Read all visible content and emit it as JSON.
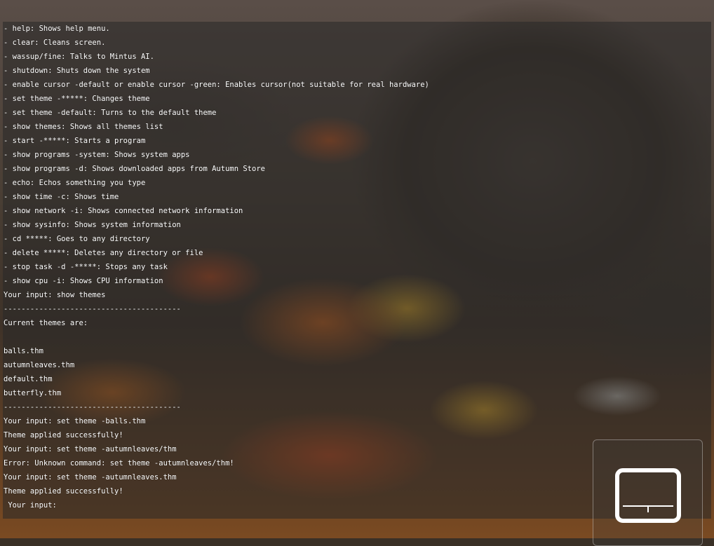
{
  "terminal": {
    "lines": [
      "- help: Shows help menu.",
      "- clear: Cleans screen.",
      "- wassup/fine: Talks to Mintus AI.",
      "- shutdown: Shuts down the system",
      "- enable cursor -default or enable cursor -green: Enables cursor(not suitable for real hardware)",
      "- set theme -*****: Changes theme",
      "- set theme -default: Turns to the default theme",
      "- show themes: Shows all themes list",
      "- start -*****: Starts a program",
      "- show programs -system: Shows system apps",
      "- show programs -d: Shows downloaded apps from Autumn Store",
      "- echo: Echos something you type",
      "- show time -c: Shows time",
      "- show network -i: Shows connected network information",
      "- show sysinfo: Shows system information",
      "- cd *****: Goes to any directory",
      "- delete *****: Deletes any directory or file",
      "- stop task -d -*****: Stops any task",
      "- show cpu -i: Shows CPU information",
      "Your input: show themes",
      "----------------------------------------",
      "Current themes are:",
      "",
      "balls.thm",
      "autumnleaves.thm",
      "default.thm",
      "butterfly.thm",
      "----------------------------------------",
      "Your input: set theme -balls.thm",
      "Theme applied successfully!",
      "Your input: set theme -autumnleaves/thm",
      "Error: Unknown command: set theme -autumnleaves/thm!",
      "Your input: set theme -autumnleaves.thm",
      "Theme applied successfully!",
      " Your input: "
    ]
  },
  "keyboard_toggle": {
    "icon": "touchscreen-keyboard-icon",
    "color": "#ffffff"
  },
  "colors": {
    "terminal_text": "#ffffff",
    "terminal_overlay": "rgba(40,40,40,0.55)"
  }
}
